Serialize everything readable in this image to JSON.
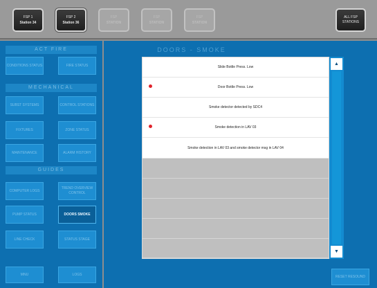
{
  "topbar": {
    "tabs": [
      {
        "line1": "FSP 1",
        "line2": "Station 34"
      },
      {
        "line1": "FSP 2",
        "line2": "Station 36"
      },
      {
        "line1": "FSP",
        "line2": "STATION"
      },
      {
        "line1": "FSP",
        "line2": "STATION"
      },
      {
        "line1": "FSP",
        "line2": "STATION"
      }
    ],
    "all_fsp": "ALL FSP STATIONS"
  },
  "left": {
    "sections": [
      "ACT FIRE",
      "MECHANICAL",
      "GUIDES"
    ],
    "buttons": [
      {
        "label": "CONDITIONS STATUS"
      },
      {
        "label": "FIRE STATUS"
      },
      {
        "label": "SUBST SYSTEMS"
      },
      {
        "label": "CONTROL STATIONS"
      },
      {
        "label": "FIXTURES"
      },
      {
        "label": "ZONE STATUS"
      },
      {
        "label": "MAINTENANCE"
      },
      {
        "label": "ALARM HISTORY"
      },
      {
        "label": "COMPUTER LOGS"
      },
      {
        "label": "TREND OVERVIEW CONTROL"
      },
      {
        "label": "PUMP STATUS"
      },
      {
        "label": "DOORS SMOKE"
      },
      {
        "label": "LINE CHECK"
      },
      {
        "label": "STATUS STAGE"
      },
      {
        "label": "MNU"
      },
      {
        "label": "LOGS"
      }
    ]
  },
  "main": {
    "title": "DOORS - SMOKE",
    "rows": [
      {
        "text": "Slide Bottle Press. Low",
        "alarm": false
      },
      {
        "text": "Door Bottle Press. Low",
        "alarm": true
      },
      {
        "text": "Smoke detector detected by SDC4",
        "alarm": false
      },
      {
        "text": "Smoke detection in LAV 03",
        "alarm": true
      },
      {
        "text": "Smoke detection in LAV 03 and smoke detector msg in LAV 04",
        "alarm": false
      }
    ],
    "reset": "RESET RESOUND"
  },
  "colors": {
    "panel": "#0d6fb0",
    "button": "#1e8ed2",
    "alarm": "#e0232b"
  },
  "icons": {
    "scroll_up": "triangle-up",
    "scroll_down": "triangle-down",
    "alarm_marker": "red-dot"
  }
}
